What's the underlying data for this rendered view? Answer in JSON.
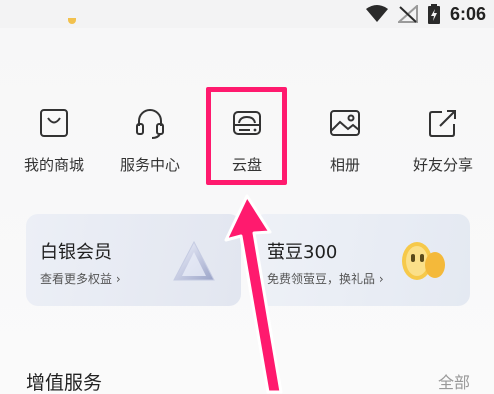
{
  "status_bar": {
    "time": "6:06",
    "icons": [
      "wifi-icon",
      "no-signal-icon",
      "battery-charging-icon"
    ]
  },
  "top_partial_text": "",
  "shortcuts": [
    {
      "label": "我的商城",
      "icon": "shop-bag-icon"
    },
    {
      "label": "服务中心",
      "icon": "headset-icon"
    },
    {
      "label": "云盘",
      "icon": "cloud-drive-icon",
      "highlighted": true
    },
    {
      "label": "相册",
      "icon": "photo-album-icon"
    },
    {
      "label": "好友分享",
      "icon": "share-icon"
    }
  ],
  "cards": {
    "silver": {
      "title": "白银会员",
      "subtitle": "查看更多权益"
    },
    "bean": {
      "title": "萤豆300",
      "subtitle": "免费领萤豆，换礼品"
    }
  },
  "section": {
    "title": "增值服务",
    "more": "全部"
  },
  "colors": {
    "highlight": "#ff1a6e",
    "background": "#f7f7f8",
    "more_text": "#999999"
  }
}
